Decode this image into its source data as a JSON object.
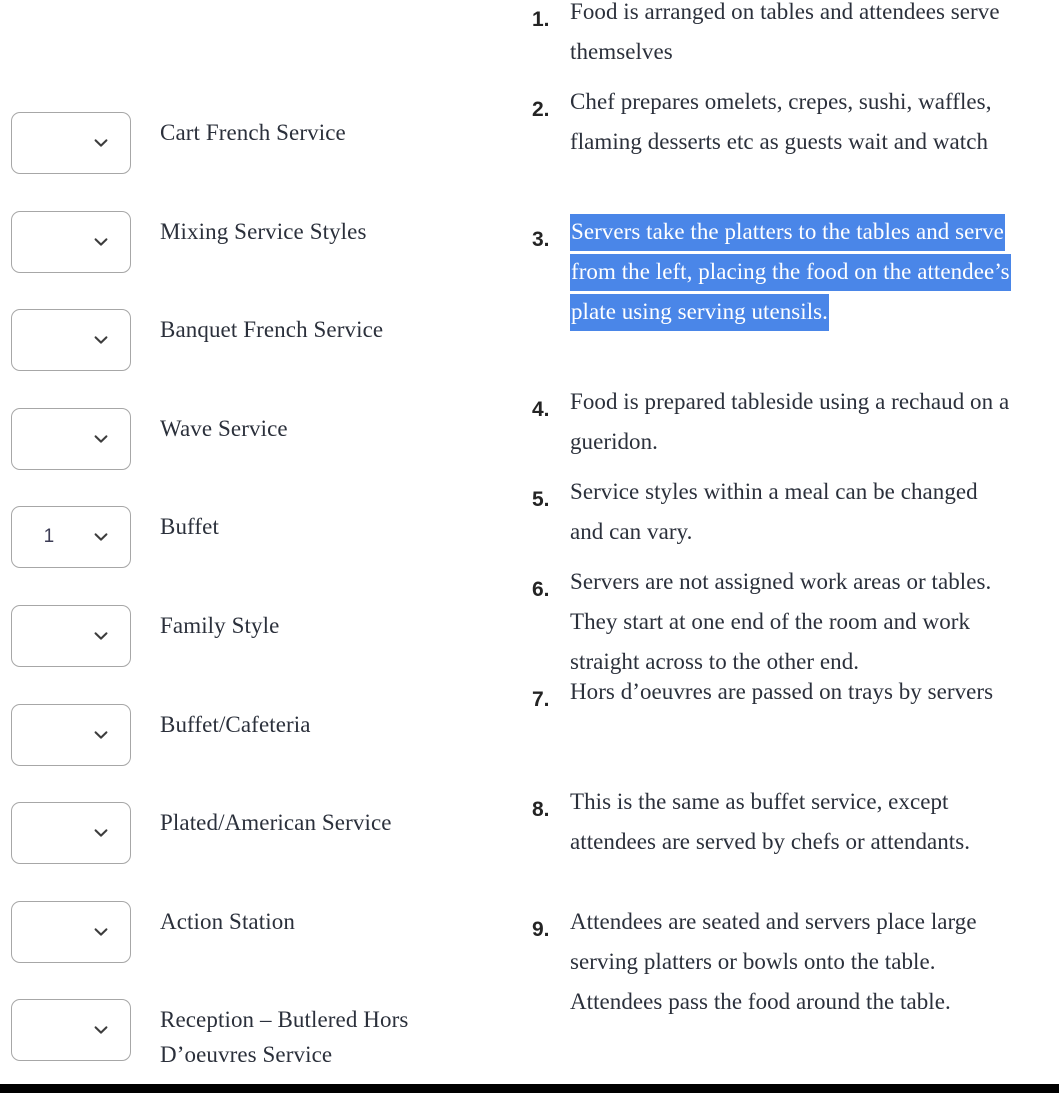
{
  "page": {
    "background_color": "#ffffff",
    "text_color": "#2b303b",
    "highlight_color": "#4a86e8",
    "highlight_text_color": "#ffffff",
    "bottom_bar_color": "#000000"
  },
  "left_column": {
    "rows": [
      {
        "dropdown_value": "",
        "icon": "chevron-down-icon",
        "label": "Cart French Service"
      },
      {
        "dropdown_value": "",
        "icon": "chevron-down-icon",
        "label": "Mixing Service Styles"
      },
      {
        "dropdown_value": "",
        "icon": "chevron-down-icon",
        "label": "Banquet French Service"
      },
      {
        "dropdown_value": "",
        "icon": "chevron-down-icon",
        "label": "Wave Service"
      },
      {
        "dropdown_value": "1",
        "icon": "chevron-down-icon",
        "label": "Buffet"
      },
      {
        "dropdown_value": "",
        "icon": "chevron-down-icon",
        "label": "Family Style"
      },
      {
        "dropdown_value": "",
        "icon": "chevron-down-icon",
        "label": "Buffet/Cafeteria"
      },
      {
        "dropdown_value": "",
        "icon": "chevron-down-icon",
        "label": "Plated/American Service"
      },
      {
        "dropdown_value": "",
        "icon": "chevron-down-icon",
        "label": "Action Station"
      },
      {
        "dropdown_value": "",
        "icon": "chevron-down-icon",
        "label": "Reception – Butlered Hors D’oeuvres Service"
      }
    ]
  },
  "right_column": {
    "items": [
      {
        "number": "1.",
        "text": "Food is arranged on tables and attendees serve themselves",
        "highlighted": false
      },
      {
        "number": "2.",
        "text": "Chef prepares omelets, crepes, sushi, waffles, flaming desserts etc as guests wait and watch",
        "highlighted": false
      },
      {
        "number": "3.",
        "text": "Servers take the platters to the tables and serve from the left, placing the food on the attendee’s plate using serving utensils.",
        "highlighted": true
      },
      {
        "number": "4.",
        "text": "Food is prepared tableside using a rechaud on a gueridon.",
        "highlighted": false
      },
      {
        "number": "5.",
        "text": "Service styles within a meal can be changed and can vary.",
        "highlighted": false
      },
      {
        "number": "6.",
        "text": "Servers are not assigned work areas or tables.  They start at one end of the room and work straight across to the other end.",
        "highlighted": false
      },
      {
        "number": "7.",
        "text": "Hors d’oeuvres are passed on trays by servers",
        "highlighted": false
      },
      {
        "number": "8.",
        "text": "This is the same as buffet service, except attendees are served by chefs or attendants.",
        "highlighted": false
      },
      {
        "number": "9.",
        "text": "Attendees are seated and servers place large serving platters or bowls onto the table. Attendees pass the food around the table.",
        "highlighted": false
      }
    ]
  }
}
